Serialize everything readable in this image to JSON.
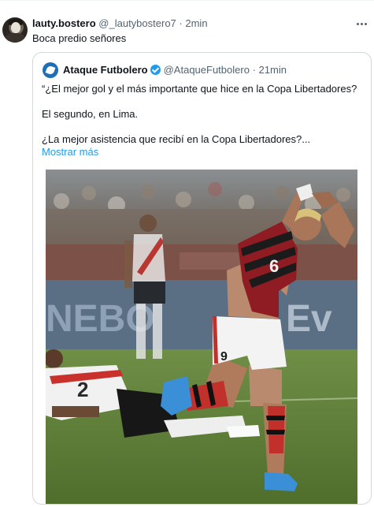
{
  "tweet": {
    "author_name": "lauty.bostero",
    "author_handle": "@_lautybostero7",
    "separator": "·",
    "time": "2min",
    "text": "Boca predio señores"
  },
  "quoted": {
    "author_name": "Ataque Futbolero",
    "author_handle": "@AtaqueFutbolero",
    "separator": "·",
    "time": "21min",
    "lines": [
      "“¿El mejor gol y el más importante que hice en la Copa Libertadores?",
      "El segundo, en Lima.",
      "¿La mejor asistencia que recibí en la Copa Libertadores?..."
    ],
    "show_more": "Mostrar más",
    "photo": {
      "billboard_text": "NEBO",
      "billboard_text_2": "Ev",
      "jersey_number_front": "6",
      "short_number": "9",
      "fallen_jersey_number": "2"
    }
  },
  "colors": {
    "link": "#1d9bf0",
    "secondary_text": "#536471",
    "border": "#cfd9de",
    "verified": "#1d9bf0"
  },
  "icons": [
    "more-icon",
    "verified-badge-icon"
  ]
}
